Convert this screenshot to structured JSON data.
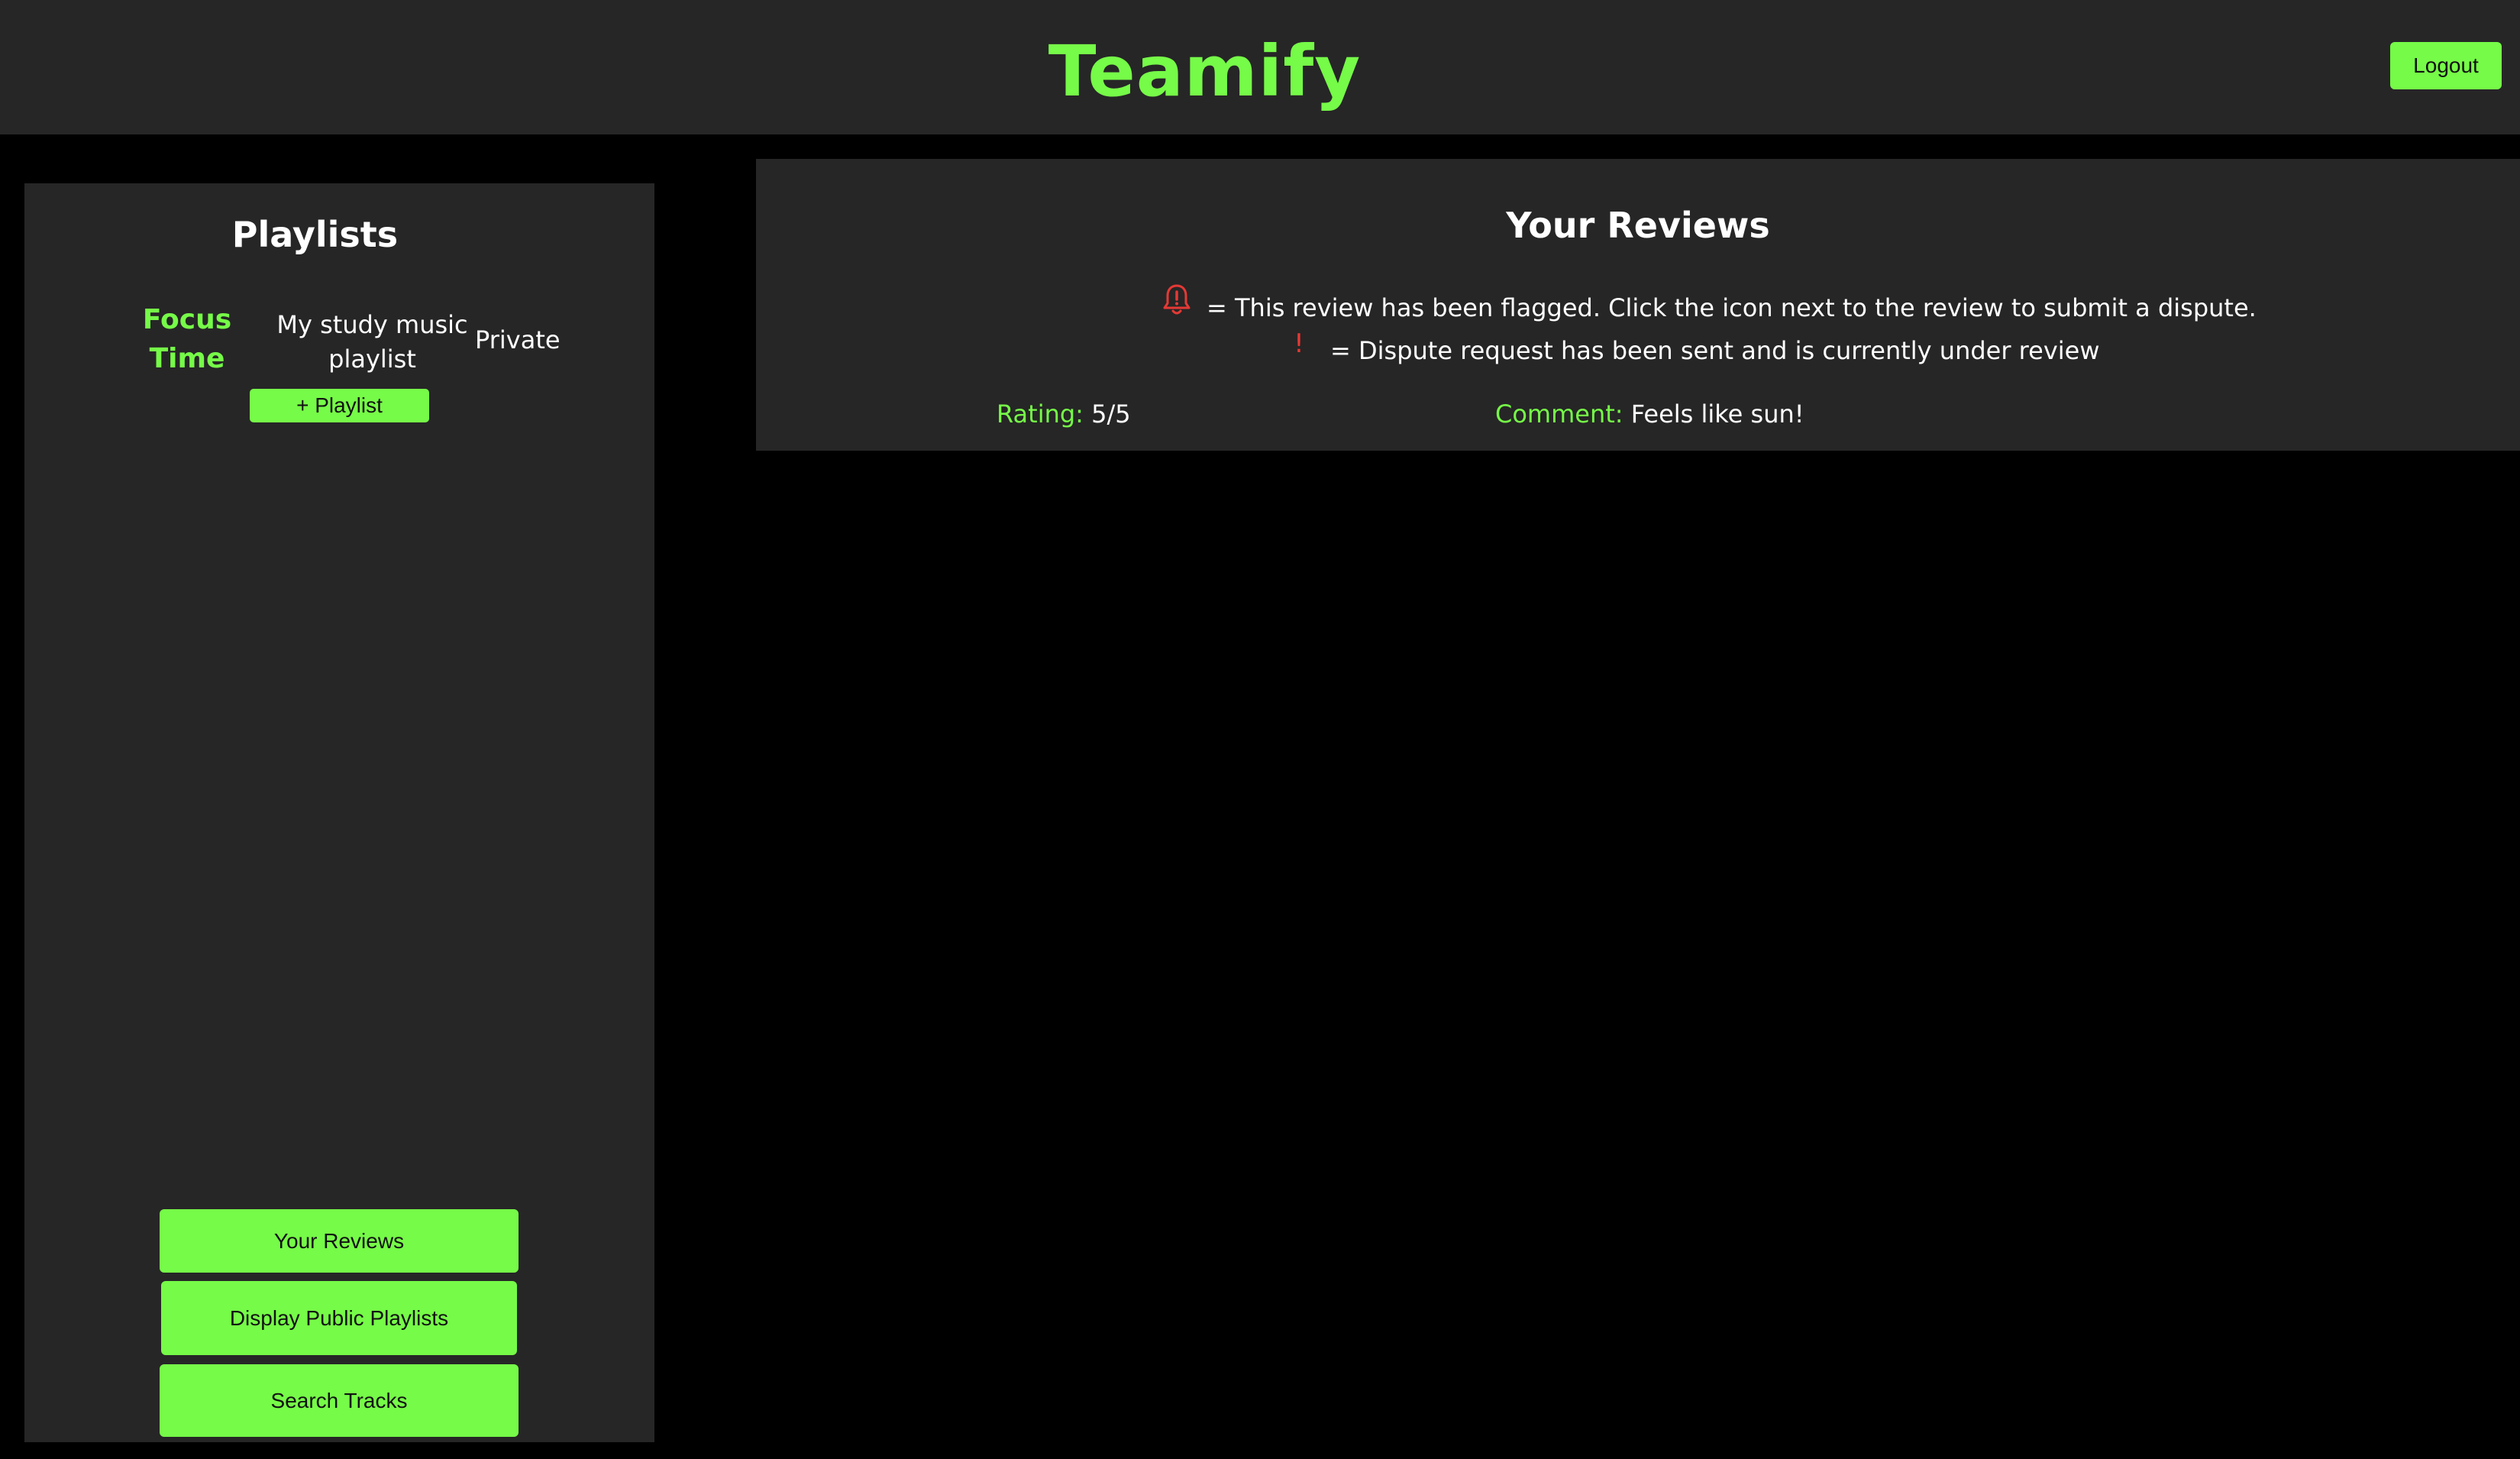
{
  "header": {
    "brand": "Teamify",
    "logout_label": "Logout"
  },
  "sidebar": {
    "title": "Playlists",
    "playlists": [
      {
        "name": "Focus Time",
        "description": "My study music playlist",
        "visibility": "Private"
      }
    ],
    "add_playlist_label": "+ Playlist",
    "buttons": {
      "your_reviews": "Your Reviews",
      "display_public_playlists": "Display Public Playlists",
      "search_tracks": "Search Tracks"
    }
  },
  "reviews": {
    "title": "Your Reviews",
    "legend": {
      "flagged_text": "= This review has been flagged. Click the icon next to the review to submit a dispute.",
      "flagged_icon": "bell-alert-icon",
      "dispute_text": "= Dispute request has been sent and is currently under review",
      "dispute_icon": "exclamation-icon",
      "dispute_symbol": "!"
    },
    "items": [
      {
        "rating_label": "Rating:",
        "rating_value": "5/5",
        "comment_label": "Comment:",
        "comment_value": "Feels like sun!"
      }
    ]
  },
  "colors": {
    "accent": "#76fb48",
    "panel": "#262626",
    "background": "#000000",
    "alert": "#e53935"
  }
}
